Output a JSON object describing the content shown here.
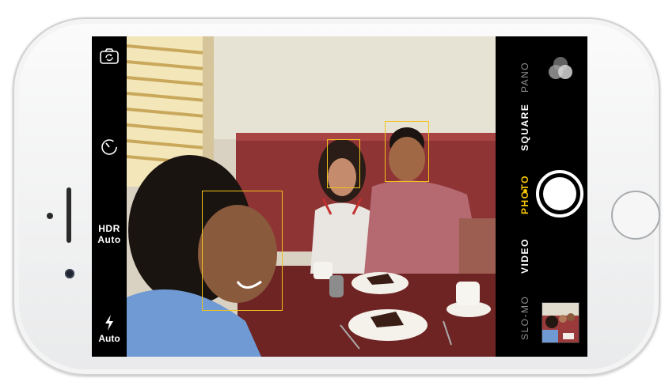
{
  "device": {
    "orientation": "landscape"
  },
  "left_controls": {
    "flip_icon": "camera-flip-icon",
    "timer_icon": "timer-icon",
    "hdr_label": "HDR",
    "hdr_value": "Auto",
    "flash_icon": "flash-icon",
    "flash_value": "Auto"
  },
  "modes": {
    "timelapse": "",
    "slomo": "SLO-MO",
    "video": "VIDEO",
    "photo": "PHOTO",
    "square": "SQUARE",
    "pano": "PANO",
    "selected": "PHOTO"
  },
  "right_controls": {
    "filters_icon": "filters-icon",
    "shutter_icon": "shutter-button",
    "thumbnail": "last-photo-thumbnail"
  },
  "viewfinder": {
    "faces_detected": 3,
    "accent_color": "#f2c21a"
  }
}
